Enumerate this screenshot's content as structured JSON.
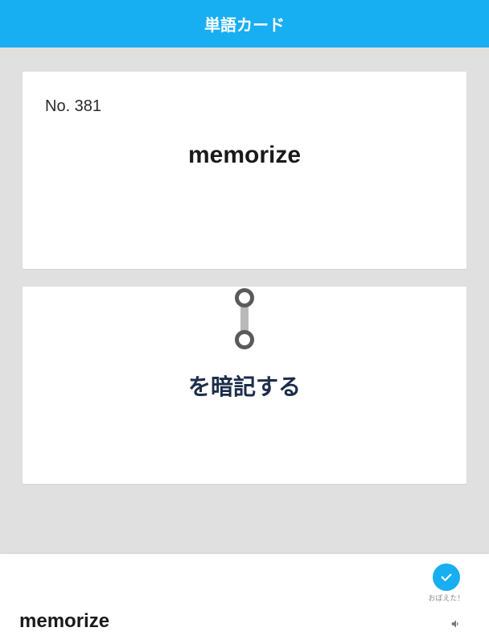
{
  "header": {
    "title": "単語カード"
  },
  "card": {
    "number": "No. 381",
    "word": "memorize",
    "meaning": "を暗記する"
  },
  "bottom": {
    "word": "memorize",
    "check_label": "おぼえた！"
  }
}
